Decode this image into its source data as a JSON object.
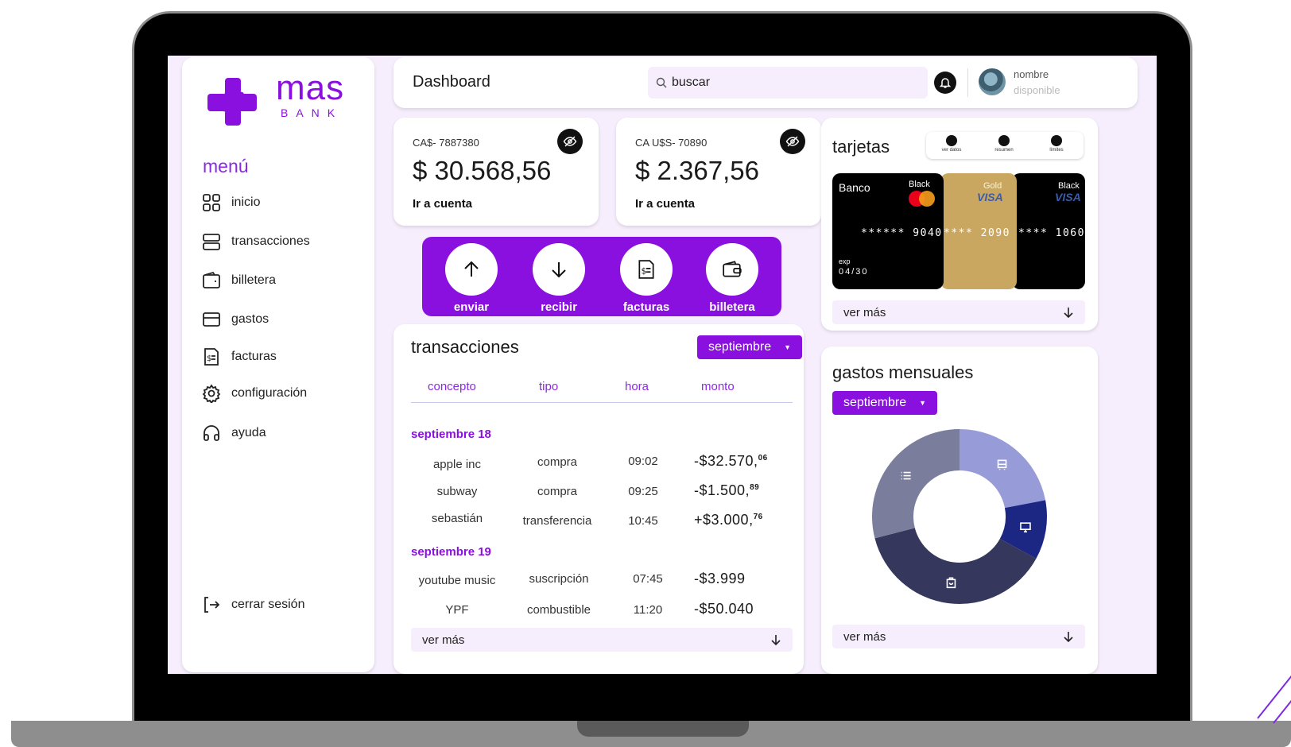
{
  "brand": {
    "name": "mas",
    "sub": "BANK",
    "accent": "#8a10e0"
  },
  "sidebar": {
    "menu_title": "menú",
    "items": [
      {
        "label": "inicio",
        "icon": "grid-icon"
      },
      {
        "label": "transacciones",
        "icon": "list-icon"
      },
      {
        "label": "billetera",
        "icon": "wallet-icon"
      },
      {
        "label": "gastos",
        "icon": "credit-card-icon"
      },
      {
        "label": "facturas",
        "icon": "invoice-icon"
      },
      {
        "label": "configuración",
        "icon": "gear-icon"
      },
      {
        "label": "ayuda",
        "icon": "headphones-icon"
      }
    ],
    "logout": "cerrar sesión"
  },
  "header": {
    "title": "Dashboard",
    "search_placeholder": "buscar",
    "user_name": "nombre",
    "user_status": "disponible"
  },
  "accounts": [
    {
      "number": "CA$- 7887380",
      "balance": "$ 30.568,56",
      "link": "Ir a cuenta"
    },
    {
      "number": "CA U$S- 70890",
      "balance": "$ 2.367,56",
      "link": "Ir a cuenta"
    }
  ],
  "actions": [
    {
      "label": "enviar",
      "icon": "arrow-up-icon"
    },
    {
      "label": "recibir",
      "icon": "arrow-down-icon"
    },
    {
      "label": "facturas",
      "icon": "invoice-icon"
    },
    {
      "label": "billetera",
      "icon": "wallet-icon"
    }
  ],
  "transactions": {
    "title": "transacciones",
    "month": "septiembre",
    "columns": [
      "concepto",
      "tipo",
      "hora",
      "monto"
    ],
    "groups": [
      {
        "date": "septiembre 18",
        "rows": [
          {
            "concept": "apple inc",
            "type": "compra",
            "time": "09:02",
            "amount": "-$32.570,",
            "cents": "06"
          },
          {
            "concept": "subway",
            "type": "compra",
            "time": "09:25",
            "amount": "-$1.500,",
            "cents": "89"
          },
          {
            "concept": "sebastián",
            "type": "transferencia",
            "time": "10:45",
            "amount": "+$3.000,",
            "cents": "76"
          }
        ]
      },
      {
        "date": "septiembre 19",
        "rows": [
          {
            "concept": "youtube music",
            "type": "suscripción",
            "time": "07:45",
            "amount": "-$3.999",
            "cents": ""
          },
          {
            "concept": "YPF",
            "type": "combustible",
            "time": "11:20",
            "amount": "-$50.040",
            "cents": ""
          }
        ]
      }
    ],
    "more": "ver más"
  },
  "cards": {
    "title": "tarjetas",
    "tools": [
      "ver datos",
      "resumen",
      "límites"
    ],
    "items": [
      {
        "bank": "Banco",
        "tier": "Black",
        "network": "mastercard",
        "number": "****** 9040",
        "exp_label": "exp",
        "exp": "04/30"
      },
      {
        "tier": "Gold",
        "network": "VISA",
        "number": "**** 2090"
      },
      {
        "tier": "Black",
        "network": "VISA",
        "number": "**** 1060"
      }
    ],
    "more": "ver más"
  },
  "spending": {
    "title": "gastos mensuales",
    "month": "septiembre",
    "more": "ver más"
  },
  "chart_data": {
    "type": "pie",
    "title": "gastos mensuales",
    "slices": [
      {
        "icon": "bus-icon",
        "value": 22,
        "color": "#979bd7"
      },
      {
        "icon": "monitor-icon",
        "value": 11,
        "color": "#1c2784"
      },
      {
        "icon": "shopping-bag-icon",
        "value": 38,
        "color": "#35375c"
      },
      {
        "icon": "list-icon",
        "value": 29,
        "color": "#7b7d9c"
      }
    ]
  }
}
